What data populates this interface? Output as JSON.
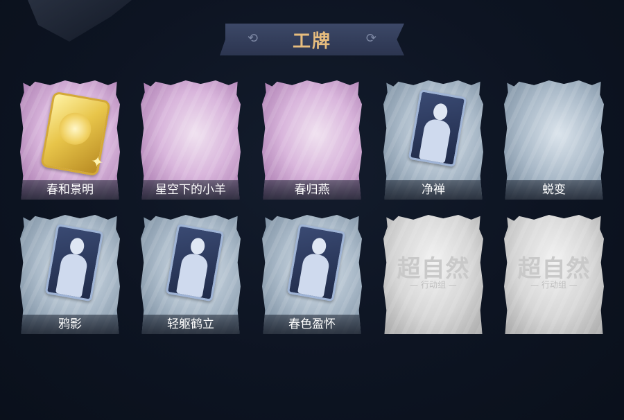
{
  "header": {
    "title": "工牌"
  },
  "cards": [
    {
      "label": "春和景明",
      "theme": "purple",
      "art": "gold-badge"
    },
    {
      "label": "星空下的小羊",
      "theme": "purple",
      "art": "blank"
    },
    {
      "label": "春归燕",
      "theme": "purple",
      "art": "blank"
    },
    {
      "label": "净禅",
      "theme": "blue",
      "art": "silhouette"
    },
    {
      "label": "蜕变",
      "theme": "blue",
      "art": "blank"
    },
    {
      "label": "鸦影",
      "theme": "blue",
      "art": "silhouette"
    },
    {
      "label": "轻躯鹤立",
      "theme": "blue",
      "art": "silhouette"
    },
    {
      "label": "春色盈怀",
      "theme": "blue",
      "art": "silhouette"
    },
    {
      "label": "",
      "theme": "grey",
      "art": "locked-logo",
      "logo_text": "超自然",
      "logo_sub": "— 行动组 —"
    },
    {
      "label": "",
      "theme": "grey",
      "art": "locked-logo",
      "logo_text": "超自然",
      "logo_sub": "— 行动组 —"
    }
  ],
  "colors": {
    "background": "#0d1422",
    "title_text": "#e7bd7e",
    "banner": "#34405d",
    "purple_theme": "#d9b6dc",
    "blue_theme": "#a9b9c8",
    "grey_theme": "#d6d6d6"
  }
}
